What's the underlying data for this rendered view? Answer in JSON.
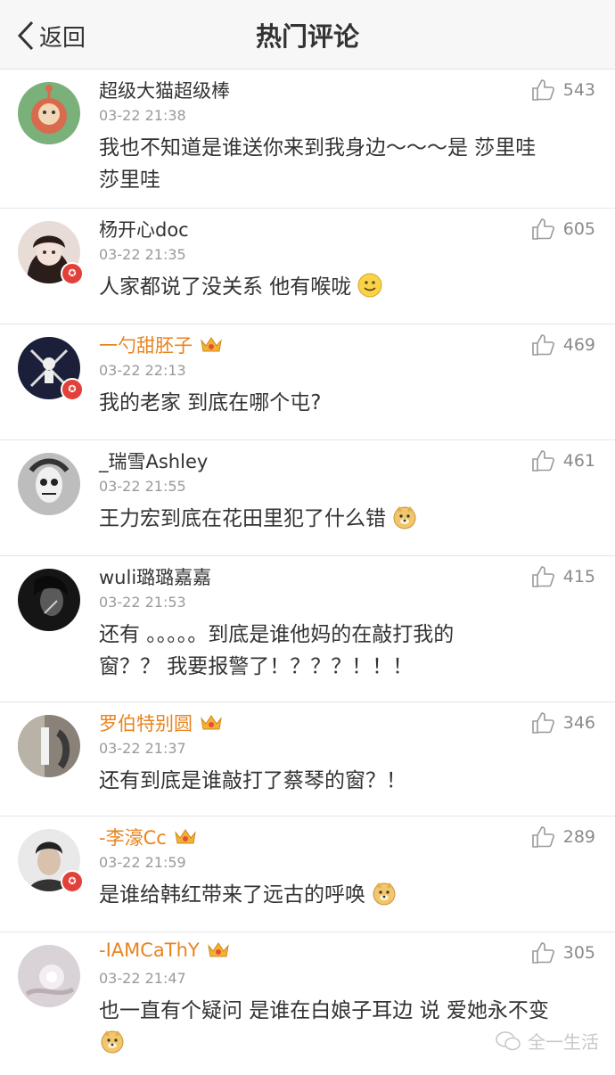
{
  "navbar": {
    "back_label": "返回",
    "title": "热门评论"
  },
  "comments": [
    {
      "name": "超级大猫超级棒",
      "time": "03-22 21:38",
      "likes": "543",
      "line1": "我也不知道是谁送你来到我身边～～～是 莎里哇",
      "line2": "莎里哇",
      "vip": false,
      "verified": false
    },
    {
      "name": "杨开心doc",
      "time": "03-22 21:35",
      "likes": "605",
      "line1": "人家都说了没关系 他有喉咙",
      "line2": "",
      "vip": false,
      "verified": true
    },
    {
      "name": "一勺甜胚子",
      "time": "03-22 22:13",
      "likes": "469",
      "line1": "我的老家 到底在哪个屯?",
      "line2": "",
      "vip": true,
      "verified": true
    },
    {
      "name": "_瑞雪Ashley",
      "time": "03-22 21:55",
      "likes": "461",
      "line1": "王力宏到底在花田里犯了什么错",
      "line2": "",
      "vip": false,
      "verified": false
    },
    {
      "name": "wuli璐璐嘉嘉",
      "time": "03-22 21:53",
      "likes": "415",
      "line1": "还有 。。。。。到底是谁他妈的在敲打我的",
      "line2": "窗？？ 我要报警了！？？？！！！",
      "vip": false,
      "verified": false
    },
    {
      "name": "罗伯特别圆",
      "time": "03-22 21:37",
      "likes": "346",
      "line1": "还有到底是谁敲打了蔡琴的窗？！",
      "line2": "",
      "vip": true,
      "verified": false
    },
    {
      "name": "-李濠Cc",
      "time": "03-22 21:59",
      "likes": "289",
      "line1": "是谁给韩红带来了远古的呼唤",
      "line2": "",
      "vip": true,
      "verified": true
    },
    {
      "name": "-IAMCaThY",
      "time": "03-22 21:47",
      "likes": "305",
      "line1": "也一直有个疑问 是谁在白娘子耳边 说 爱她永不变",
      "line2": "",
      "vip": true,
      "verified": false
    }
  ],
  "watermark": "全一生活"
}
